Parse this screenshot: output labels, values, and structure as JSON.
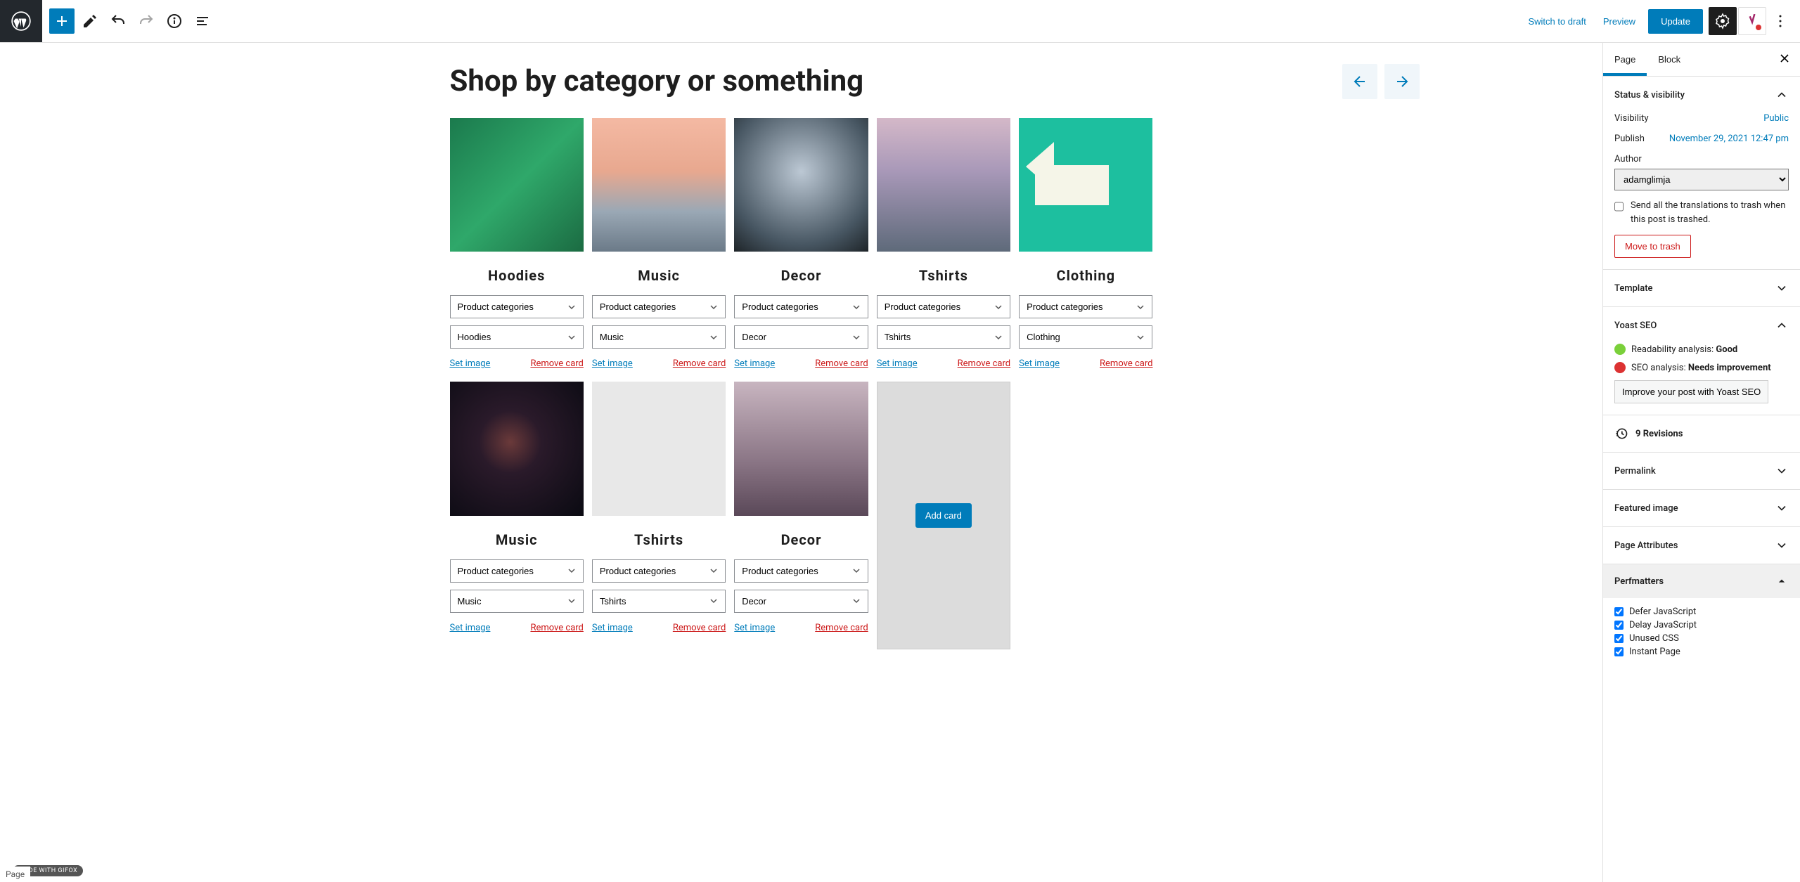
{
  "topbar": {
    "switch_draft": "Switch to draft",
    "preview": "Preview",
    "update": "Update"
  },
  "page": {
    "title": "Shop by category or something"
  },
  "cards_row1": [
    {
      "title": "Hoodies",
      "img_class": "img-boat",
      "sel1": "Product categories",
      "sel2": "Hoodies"
    },
    {
      "title": "Music",
      "img_class": "img-sunset",
      "sel1": "Product categories",
      "sel2": "Music"
    },
    {
      "title": "Decor",
      "img_class": "img-window",
      "sel1": "Product categories",
      "sel2": "Decor"
    },
    {
      "title": "Tshirts",
      "img_class": "img-eiffel",
      "sel1": "Product categories",
      "sel2": "Tshirts"
    },
    {
      "title": "Clothing",
      "img_class": "img-arrow",
      "sel1": "Product categories",
      "sel2": "Clothing"
    }
  ],
  "cards_row2": [
    {
      "title": "Music",
      "img_class": "img-space",
      "sel1": "Product categories",
      "sel2": "Music"
    },
    {
      "title": "Tshirts",
      "img_class": "img-tshirt",
      "sel1": "Product categories",
      "sel2": "Tshirts"
    },
    {
      "title": "Decor",
      "img_class": "img-hands",
      "sel1": "Product categories",
      "sel2": "Decor"
    }
  ],
  "card_labels": {
    "set_image": "Set image",
    "remove_card": "Remove card",
    "add_card": "Add card"
  },
  "sidebar": {
    "tabs": {
      "page": "Page",
      "block": "Block"
    },
    "status_visibility": "Status & visibility",
    "visibility_label": "Visibility",
    "visibility_value": "Public",
    "publish_label": "Publish",
    "publish_value": "November 29, 2021 12:47 pm",
    "author_label": "Author",
    "author_value": "adamglimja",
    "trash_translations": "Send all the translations to trash when this post is trashed.",
    "move_trash": "Move to trash",
    "template": "Template",
    "yoast": "Yoast SEO",
    "readability_label": "Readability analysis:",
    "readability_value": "Good",
    "seo_label": "SEO analysis:",
    "seo_value": "Needs improvement",
    "improve": "Improve your post with Yoast SEO",
    "revisions": "9 Revisions",
    "permalink": "Permalink",
    "featured_image": "Featured image",
    "page_attributes": "Page Attributes",
    "perfmatters": "Perfmatters",
    "perf": {
      "defer": "Defer JavaScript",
      "delay": "Delay JavaScript",
      "unused": "Unused CSS",
      "instant": "Instant Page"
    }
  },
  "footer": "Page",
  "gifox": "MADE WITH GIFOX"
}
